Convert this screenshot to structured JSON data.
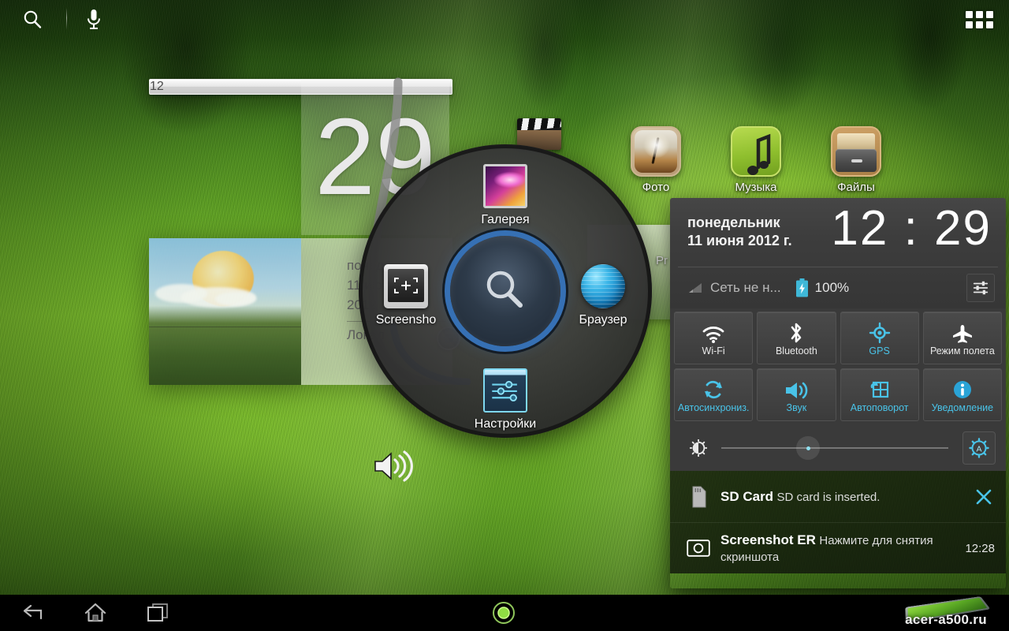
{
  "statusbar": {
    "search_icon": "search-icon",
    "mic_icon": "microphone-icon",
    "apps_icon": "apps-grid-icon"
  },
  "clock_widget": {
    "hours": "12",
    "minutes": "29",
    "day_line": "понед",
    "date_line": "11 ию",
    "year_line": "2012",
    "location": "Локал",
    "weather_icon": "sun-cloud-icon"
  },
  "desktop_apps": [
    {
      "label": "Фото",
      "icon": "dandelion-photo-icon"
    },
    {
      "label": "Музыка",
      "icon": "music-note-icon"
    },
    {
      "label": "Файлы",
      "icon": "file-drawer-icon"
    },
    {
      "label": "Pr",
      "icon": "movie-clapper-icon"
    }
  ],
  "pie": {
    "center_icon": "search-magnifier-icon",
    "items": [
      {
        "label": "Галерея",
        "icon": "gallery-icon"
      },
      {
        "label": "Браузер",
        "icon": "browser-globe-icon"
      },
      {
        "label": "Настройки",
        "icon": "settings-sliders-icon"
      },
      {
        "label": "Screensho",
        "icon": "screenshot-icon"
      }
    ]
  },
  "volume_glyph": "speaker-volume-icon",
  "panel": {
    "day": "понедельник",
    "date": "11 июня 2012 г.",
    "time": "12 : 29",
    "network_label": "Сеть не н...",
    "battery_label": "100%",
    "signal_icon": "signal-bars-icon",
    "battery_icon": "battery-charging-icon",
    "settings_icon": "sliders-settings-icon",
    "toggles": [
      {
        "label": "Wi-Fi",
        "icon": "wifi-icon",
        "active": false
      },
      {
        "label": "Bluetooth",
        "icon": "bluetooth-icon",
        "active": false
      },
      {
        "label": "GPS",
        "icon": "gps-icon",
        "active": true
      },
      {
        "label": "Режим полета",
        "icon": "airplane-icon",
        "active": false
      },
      {
        "label": "Автосинхрониз.",
        "icon": "sync-icon",
        "active": true
      },
      {
        "label": "Звук",
        "icon": "sound-icon",
        "active": true
      },
      {
        "label": "Автоповорот",
        "icon": "auto-rotate-icon",
        "active": true
      },
      {
        "label": "Уведомление",
        "icon": "info-icon",
        "active": true
      }
    ],
    "brightness": {
      "icon": "brightness-icon",
      "value_percent": 35,
      "auto_icon": "auto-brightness-icon"
    },
    "notifications": [
      {
        "title": "SD Card",
        "subtitle": "SD card is inserted.",
        "time": "",
        "icon": "sd-card-icon",
        "has_close": true
      },
      {
        "title": "Screenshot ER",
        "subtitle": "Нажмите для снятия скриншота",
        "time": "12:28",
        "icon": "camera-icon",
        "has_close": false
      }
    ]
  },
  "navbar": {
    "back_icon": "back-arrow-icon",
    "home_icon": "home-icon",
    "recent_icon": "recent-apps-icon",
    "pie_trigger_icon": "pie-trigger-icon",
    "watermark": "acer-a500.ru"
  },
  "colors": {
    "accent_cyan": "#49c3e8",
    "panel_bg": "#3a3a3a",
    "nav_bg": "#000000"
  }
}
